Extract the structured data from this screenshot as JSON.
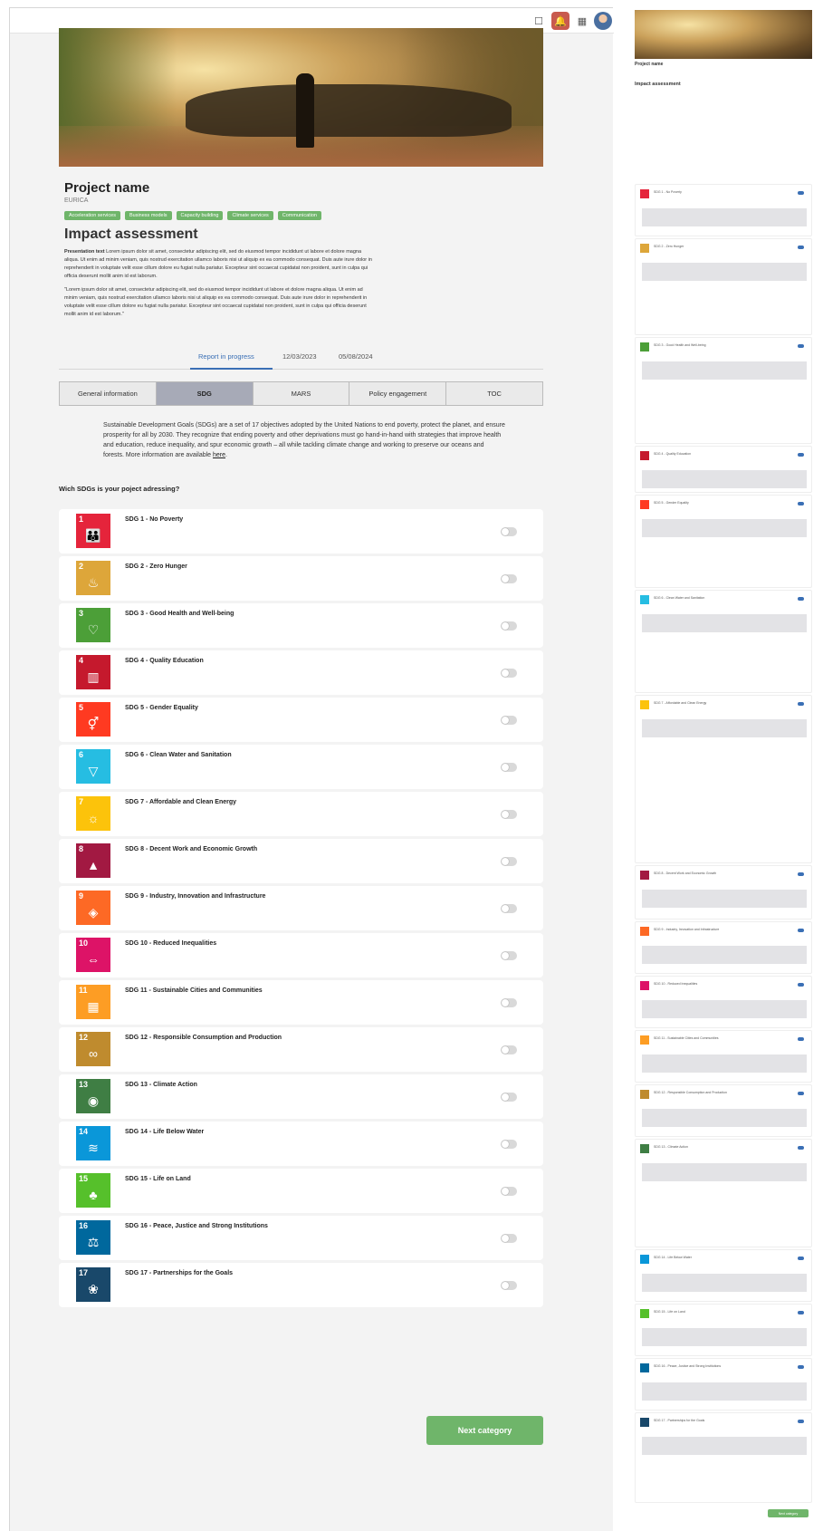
{
  "project": {
    "name": "Project name",
    "subtitle": "EURICA",
    "tags": [
      "Acceleration services",
      "Business models",
      "Capacity building",
      "Climate services",
      "Communication"
    ]
  },
  "impact": {
    "title": "Impact assessment",
    "para1_lead": "Presentation text",
    "para1": "Lorem ipsum dolor sit amet, consectetur adipiscing elit, sed do eiusmod tempor incididunt ut labore et dolore magna aliqua. Ut enim ad minim veniam, quis nostrud exercitation ullamco laboris nisi ut aliquip ex ea commodo consequat. Duis aute irure dolor in reprehenderit in voluptate velit esse cillum dolore eu fugiat nulla pariatur. Excepteur sint occaecat cupidatat non proident, sunt in culpa qui officia deserunt mollit anim id est laborum.",
    "para2": "\"Lorem ipsum dolor sit amet, consectetur adipiscing elit, sed do eiusmod tempor incididunt ut labore et dolore magna aliqua. Ut enim ad minim veniam, quis nostrud exercitation ullamco laboris nisi ut aliquip ex ea commodo consequat. Duis aute irure dolor in reprehenderit in voluptate velit esse cillum dolore eu fugiat nulla pariatur. Excepteur sint occaecat cupidatat non proident, sunt in culpa qui officia deserunt mollit anim id est laborum.\""
  },
  "status": {
    "label": "Report in progress",
    "date1": "12/03/2023",
    "date2": "05/08/2024"
  },
  "tabs": [
    "General information",
    "SDG",
    "MARS",
    "Policy engagement",
    "TOC"
  ],
  "intro": {
    "text": "Sustainable Development Goals (SDGs) are a set of 17 objectives adopted by the United Nations to end poverty, protect the planet, and ensure prosperity for all by 2030. They recognize that ending poverty and other deprivations must go hand-in-hand with strategies that improve health and education, reduce inequality, and spur economic growth – all while tackling climate change and working to preserve our oceans and forests. More information are available ",
    "link": "here",
    "end": "."
  },
  "question": "Wich SDGs is your poject adressing?",
  "sdgs": [
    {
      "name": "SDG 1 - No Poverty",
      "color": "#e5243b",
      "icon": "family-icon",
      "glyph": "👪"
    },
    {
      "name": "SDG 2 - Zero Hunger",
      "color": "#dda63a",
      "icon": "bowl-icon",
      "glyph": "♨"
    },
    {
      "name": "SDG 3 - Good Health and Well-being",
      "color": "#4c9f38",
      "icon": "heartbeat-icon",
      "glyph": "♡"
    },
    {
      "name": "SDG 4 - Quality Education",
      "color": "#c5192d",
      "icon": "book-icon",
      "glyph": "▥"
    },
    {
      "name": "SDG 5 - Gender Equality",
      "color": "#ff3a21",
      "icon": "gender-icon",
      "glyph": "⚥"
    },
    {
      "name": "SDG 6 - Clean Water and Sanitation",
      "color": "#26bde2",
      "icon": "water-icon",
      "glyph": "▽"
    },
    {
      "name": "SDG 7 - Affordable and Clean Energy",
      "color": "#fcc30b",
      "icon": "sun-icon",
      "glyph": "☼"
    },
    {
      "name": "SDG 8 - Decent Work and Economic Growth",
      "color": "#a21942",
      "icon": "growth-chart-icon",
      "glyph": "▲"
    },
    {
      "name": "SDG 9 - Industry, Innovation and Infrastructure",
      "color": "#fd6925",
      "icon": "cubes-icon",
      "glyph": "◈"
    },
    {
      "name": "SDG 10 - Reduced Inequalities",
      "color": "#dd1367",
      "icon": "equals-icon",
      "glyph": "⇔"
    },
    {
      "name": "SDG 11 - Sustainable Cities and Communities",
      "color": "#fd9d24",
      "icon": "city-icon",
      "glyph": "▦"
    },
    {
      "name": "SDG 12 - Responsible Consumption and Production",
      "color": "#bf8b2e",
      "icon": "infinity-icon",
      "glyph": "∞"
    },
    {
      "name": "SDG 13 - Climate Action",
      "color": "#3f7e44",
      "icon": "eye-globe-icon",
      "glyph": "◉"
    },
    {
      "name": "SDG 14 - Life Below Water",
      "color": "#0a97d9",
      "icon": "fish-icon",
      "glyph": "≋"
    },
    {
      "name": "SDG 15 - Life on Land",
      "color": "#56c02b",
      "icon": "tree-icon",
      "glyph": "♣"
    },
    {
      "name": "SDG 16 - Peace, Justice and Strong Institutions",
      "color": "#00689d",
      "icon": "dove-icon",
      "glyph": "⚖"
    },
    {
      "name": "SDG 17 - Partnerships for the Goals",
      "color": "#19486a",
      "icon": "flower-icon",
      "glyph": "❀"
    }
  ],
  "next_label": "Next category",
  "side": {
    "heading": "Project name",
    "title": "Impact assessment",
    "next_label": "Next category"
  }
}
